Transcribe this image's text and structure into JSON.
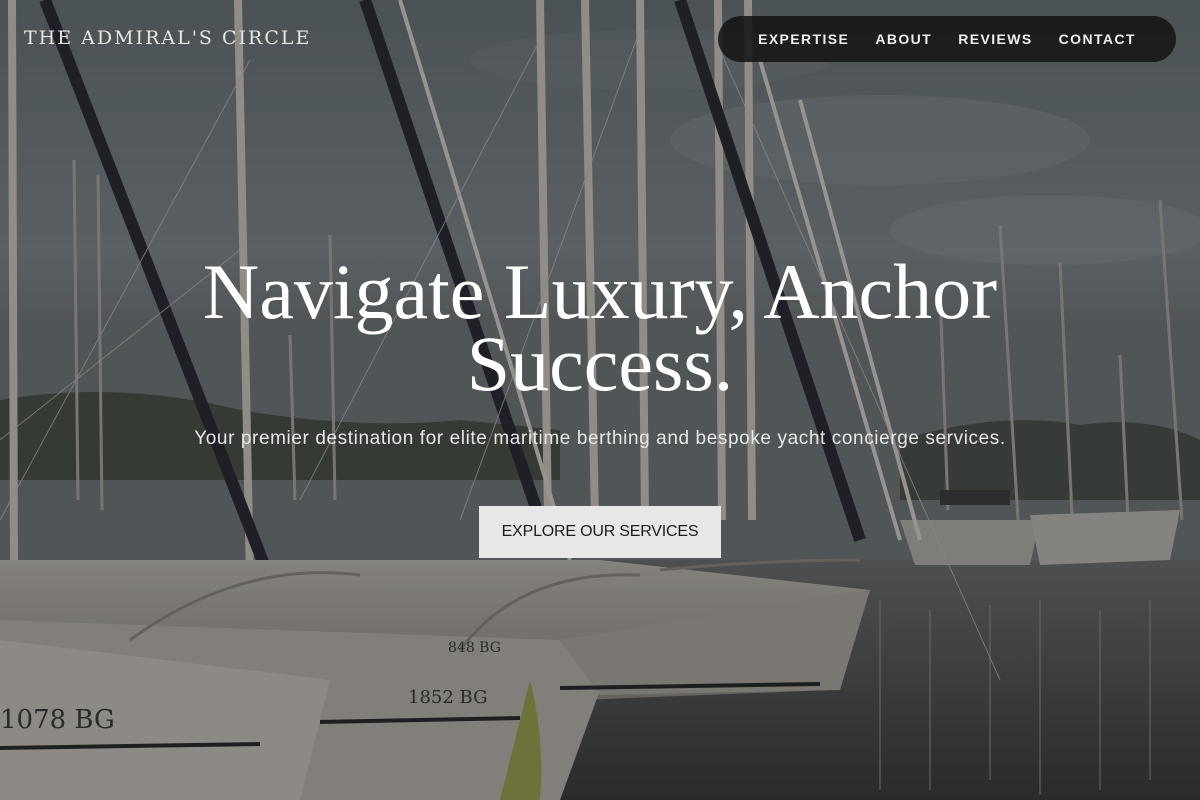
{
  "brand": {
    "name": "THE ADMIRAL'S CIRCLE"
  },
  "nav": {
    "items": [
      {
        "label": "EXPERTISE"
      },
      {
        "label": "ABOUT"
      },
      {
        "label": "REVIEWS"
      },
      {
        "label": "CONTACT"
      }
    ]
  },
  "hero": {
    "headline": "Navigate Luxury, Anchor Success.",
    "subtitle": "Your premier destination for elite maritime berthing and bespoke yacht concierge services.",
    "cta_label": "EXPLORE OUR SERVICES",
    "background": {
      "hull_numbers": [
        "1078 BG",
        "1852 BG",
        "848 BG"
      ]
    }
  },
  "colors": {
    "nav_background": "#141414",
    "button_background": "#e7e7e7",
    "button_text": "#1c1c1c",
    "text_light": "#ffffff"
  }
}
